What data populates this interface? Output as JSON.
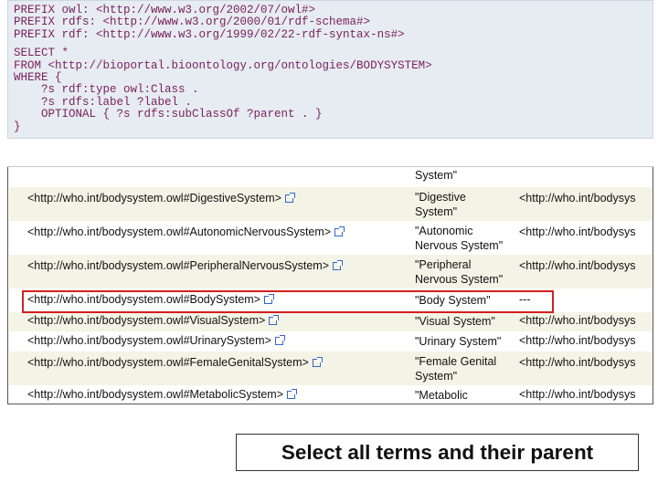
{
  "query": {
    "lines": [
      "PREFIX owl: <http://www.w3.org/2002/07/owl#>",
      "PREFIX rdfs: <http://www.w3.org/2000/01/rdf-schema#>",
      "PREFIX rdf: <http://www.w3.org/1999/02/22-rdf-syntax-ns#>",
      "",
      "SELECT *",
      "FROM <http://bioportal.bioontology.org/ontologies/BODYSYSTEM>",
      "WHERE {",
      "    ?s rdf:type owl:Class .",
      "    ?s rdfs:label ?label .",
      "    OPTIONAL { ?s rdfs:subClassOf ?parent . }",
      "}"
    ]
  },
  "results": {
    "partial_top_label": "System\"",
    "rows": [
      {
        "s": "<http://who.int/bodysystem.owl#DigestiveSystem>",
        "label1": "\"Digestive",
        "label2": "System\"",
        "parent": "<http://who.int/bodysys"
      },
      {
        "s": "<http://who.int/bodysystem.owl#AutonomicNervousSystem>",
        "label1": "\"Autonomic",
        "label2": "Nervous System\"",
        "parent": "<http://who.int/bodysys"
      },
      {
        "s": "<http://who.int/bodysystem.owl#PeripheralNervousSystem>",
        "label1": "\"Peripheral",
        "label2": "Nervous System\"",
        "parent": "<http://who.int/bodysys"
      },
      {
        "s": "<http://who.int/bodysystem.owl#BodySystem>",
        "label1": "\"Body System\"",
        "label2": "",
        "parent": "---"
      },
      {
        "s": "<http://who.int/bodysystem.owl#VisualSystem>",
        "label1": "\"Visual System\"",
        "label2": "",
        "parent": "<http://who.int/bodysys"
      },
      {
        "s": "<http://who.int/bodysystem.owl#UrinarySystem>",
        "label1": "\"Urinary System\"",
        "label2": "",
        "parent": "<http://who.int/bodysys"
      },
      {
        "s": "<http://who.int/bodysystem.owl#FemaleGenitalSystem>",
        "label1": "\"Female Genital",
        "label2": "System\"",
        "parent": "<http://who.int/bodysys"
      },
      {
        "s": "<http://who.int/bodysystem.owl#MetabolicSystem>",
        "label1": "\"Metabolic",
        "label2": "",
        "parent": "<http://who.int/bodysys"
      }
    ]
  },
  "caption": "Select all terms and their parent"
}
